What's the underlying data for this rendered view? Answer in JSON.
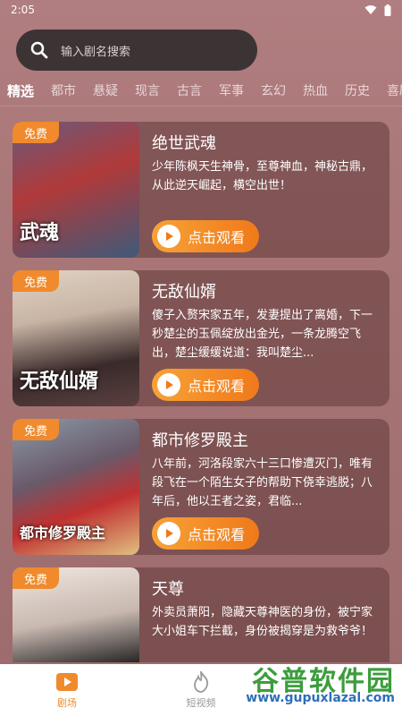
{
  "status_bar": {
    "time": "2:05"
  },
  "search": {
    "placeholder": "输入剧名搜索"
  },
  "tabs": [
    "精选",
    "都市",
    "悬疑",
    "现言",
    "古言",
    "军事",
    "玄幻",
    "热血",
    "历史",
    "喜剧"
  ],
  "active_tab": "精选",
  "cards": [
    {
      "badge": "免费",
      "poster_text": "武魂",
      "title": "绝世武魂",
      "desc": "少年陈枫天生神骨，至尊神血，神秘古鼎，从此逆天崛起，横空出世！",
      "button": "点击观看",
      "poster_colors": [
        "#5a4a6a",
        "#b03a3a",
        "#3e5a7a"
      ]
    },
    {
      "badge": "免费",
      "poster_text": "无敌仙婿",
      "title": "无敌仙婿",
      "desc": "傻子入赘宋家五年，发妻提出了离婚，下一秒楚尘的玉佩绽放出金光，一条龙腾空飞出，楚尘缓缓说道：我叫楚尘...",
      "button": "点击观看",
      "poster_colors": [
        "#d8c6b8",
        "#3a2a2a",
        "#8a6a5a"
      ]
    },
    {
      "badge": "免费",
      "poster_text": "都市修罗殿主",
      "title": "都市修罗殿主",
      "desc": "八年前，河洛段家六十三口惨遭灭门，唯有段飞在一个陌生女子的帮助下侥幸逃脱；八年后，他以王者之姿，君临...",
      "button": "点击观看",
      "poster_colors": [
        "#6a7a8a",
        "#c03030",
        "#e0c080"
      ]
    },
    {
      "badge": "免费",
      "poster_text": "",
      "title": "天尊",
      "desc": "外卖员萧阳，隐藏天尊神医的身份，被宁家大小姐车下拦截，身份被揭穿是为救爷爷！",
      "button": "点击观看",
      "poster_colors": [
        "#e8ddd8",
        "#222222",
        "#b8a8a0"
      ]
    }
  ],
  "bottom_nav": [
    {
      "label": "剧场",
      "icon": "theater-icon",
      "active": true
    },
    {
      "label": "短视频",
      "icon": "flame-icon",
      "active": false
    },
    {
      "label": "",
      "icon": "",
      "active": false
    }
  ],
  "watermark": {
    "cn": "谷普软件园",
    "url": "www.gupuxlazal.com"
  },
  "colors": {
    "accent": "#f08a2c",
    "background": "#a87576",
    "search_bg": "#3c3434"
  }
}
